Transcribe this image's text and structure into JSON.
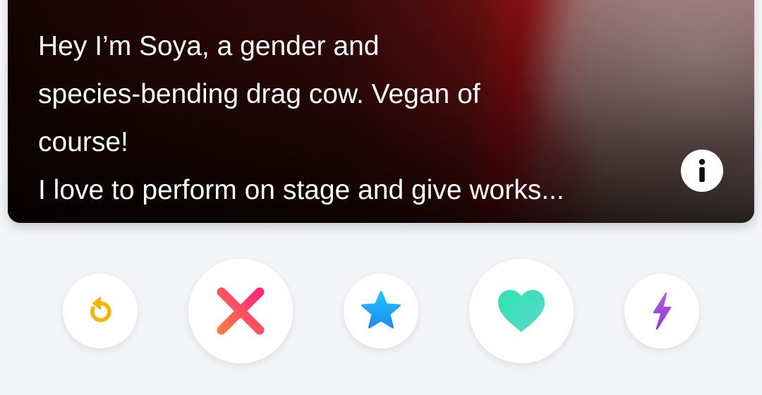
{
  "profile": {
    "bio_lines": [
      "Hey I’m Soya, a gender and",
      "species-bending drag cow. Vegan of",
      "course!",
      "I love to perform on stage and give works..."
    ],
    "info_icon": "info-icon"
  },
  "actions": [
    {
      "name": "rewind",
      "icon": "rewind-icon",
      "color": "#f5b400"
    },
    {
      "name": "nope",
      "icon": "close-x-icon",
      "color": [
        "#fd267a",
        "#ff6036"
      ]
    },
    {
      "name": "super-like",
      "icon": "star-icon",
      "color": [
        "#1db3ff",
        "#2d8ff5"
      ]
    },
    {
      "name": "like",
      "icon": "heart-icon",
      "color": [
        "#2ee5b0",
        "#56d6c9"
      ]
    },
    {
      "name": "boost",
      "icon": "lightning-icon",
      "color": [
        "#b04ce8",
        "#8c3dd8"
      ]
    }
  ]
}
